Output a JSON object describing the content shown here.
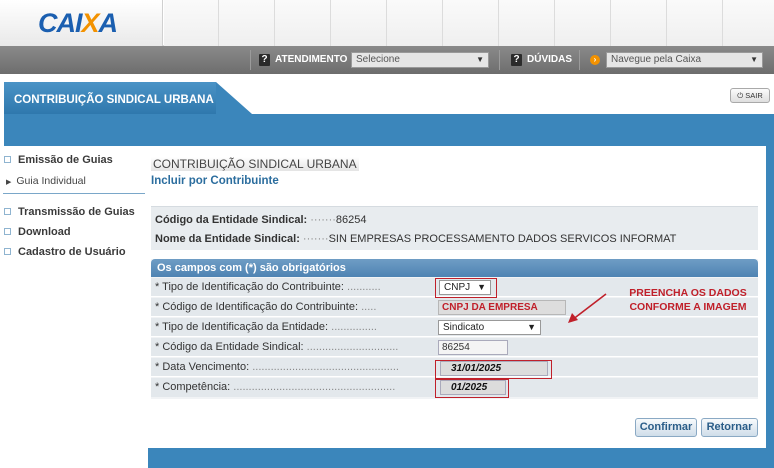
{
  "brand": {
    "logo_text_a": "CAI",
    "logo_text_x": "X",
    "logo_text_b": "A"
  },
  "service_bar": {
    "atendimento_label": "ATENDIMENTO",
    "atendimento_select": "Selecione",
    "duvidas_label": "DÚVIDAS",
    "navegue_select": "Navegue pela Caixa",
    "question_glyph": "?"
  },
  "header": {
    "tab_title": "CONTRIBUIÇÃO SINDICAL URBANA",
    "sair_label": "SAIR"
  },
  "sidebar": {
    "items": [
      {
        "label": "Emissão de Guias"
      },
      {
        "label": "Guia Individual"
      },
      {
        "label": "Transmissão de Guias"
      },
      {
        "label": "Download"
      },
      {
        "label": "Cadastro de Usuário"
      }
    ]
  },
  "main": {
    "title": "CONTRIBUIÇÃO SINDICAL URBANA",
    "subtitle": "Incluir por Contribuinte",
    "entity": {
      "codigo_label": "Código da Entidade Sindical:",
      "codigo_dots": "·······",
      "codigo_value": "86254",
      "nome_label": "Nome da Entidade Sindical:",
      "nome_dots": "·······",
      "nome_value": "SIN EMPRESAS PROCESSAMENTO DADOS SERVICOS INFORMAT"
    },
    "form": {
      "header": "Os campos com (*) são obrigatórios",
      "rows": [
        {
          "label": "* Tipo de Identificação do Contribuinte:",
          "dots": "...........",
          "value": "CNPJ"
        },
        {
          "label": "* Código de Identificação do Contribuinte:",
          "dots": ".....",
          "value": "CNPJ DA EMPRESA"
        },
        {
          "label": "* Tipo de Identificação da Entidade:",
          "dots": "...............",
          "value": "Sindicato"
        },
        {
          "label": "* Código da Entidade Sindical:",
          "dots": "..............................",
          "value": "86254"
        },
        {
          "label": "* Data Vencimento:",
          "dots": "................................................",
          "value": "31/01/2025"
        },
        {
          "label": "* Competência:",
          "dots": ".....................................................",
          "value": "01/2025"
        }
      ]
    },
    "annotation": {
      "line1": "PREENCHA OS DADOS",
      "line2": "CONFORME A IMAGEM"
    },
    "buttons": {
      "confirmar": "Confirmar",
      "retornar": "Retornar"
    }
  }
}
